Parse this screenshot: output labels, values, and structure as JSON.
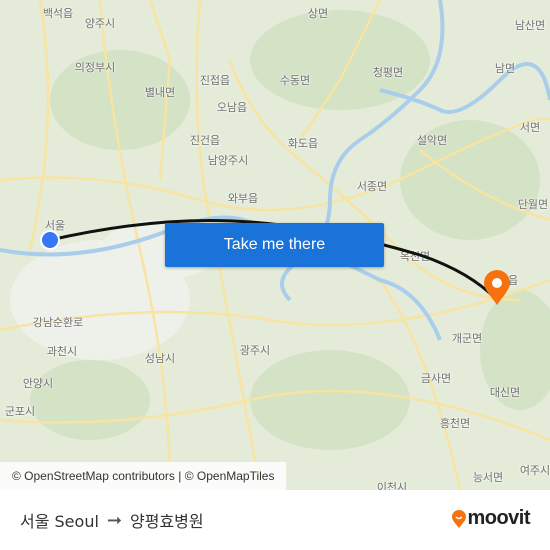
{
  "map": {
    "labels": [
      "백석읍",
      "양주시",
      "상면",
      "남산면",
      "의정부시",
      "진접읍",
      "청평면",
      "남면",
      "별내면",
      "수동면",
      "오남읍",
      "서면",
      "진건읍",
      "화도읍",
      "설악면",
      "남양주시",
      "서종면",
      "와부읍",
      "단월면",
      "서울",
      "옥천면",
      "양평읍",
      "강남순환로",
      "과천시",
      "광주시",
      "성남시",
      "개군면",
      "안양시",
      "금사면",
      "대신면",
      "군포시",
      "흥천면",
      "능서면",
      "여주시",
      "이천시"
    ],
    "origin_color": "#3478f6",
    "destination_color": "#f5720f",
    "attribution": "© OpenStreetMap contributors | © OpenMapTiles"
  },
  "cta": {
    "label": "Take me there",
    "color": "#1a73d9"
  },
  "footer": {
    "origin": "서울 Seoul",
    "arrow_icon": "arrow-right-icon",
    "destination": "양평효병원",
    "brand": "moovit",
    "brand_color": "#f5720f"
  }
}
